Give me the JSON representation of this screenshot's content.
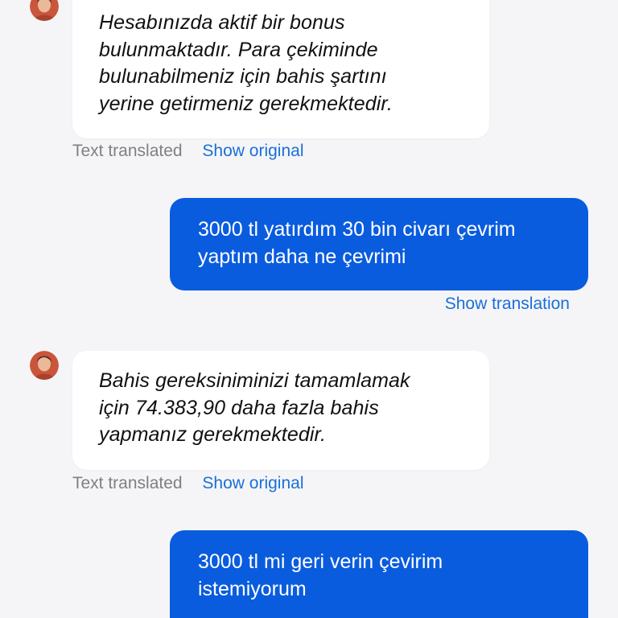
{
  "colors": {
    "background": "#f5f5f7",
    "incoming_bubble": "#ffffff",
    "outgoing_bubble": "#0a5cde",
    "link": "#1a6fd9",
    "muted": "#808080"
  },
  "messages": [
    {
      "direction": "incoming",
      "lines": [
        "Hesabınızda aktif bir bonus",
        "bulunmaktadır. Para çekiminde",
        "bulunabilmeniz için bahis şartını",
        "yerine getirmeniz gerekmektedir."
      ],
      "status": "Text translated",
      "action": "Show original"
    },
    {
      "direction": "outgoing",
      "lines": [
        "3000 tl yatırdım 30 bin civarı çevrim",
        "yaptım daha ne çevrimi"
      ],
      "action": "Show translation"
    },
    {
      "direction": "incoming",
      "lines": [
        "Bahis gereksiniminizi tamamlamak",
        "için 74.383,90 daha fazla bahis",
        "yapmanız gerekmektedir."
      ],
      "status": "Text translated",
      "action": "Show original"
    },
    {
      "direction": "outgoing",
      "lines": [
        "3000 tl mi geri verin çevirim",
        "istemiyorum"
      ]
    }
  ]
}
